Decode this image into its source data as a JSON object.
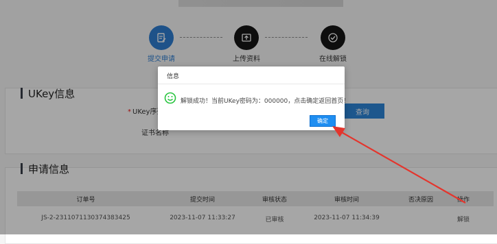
{
  "steps": [
    {
      "label": "提交申请",
      "icon": "edit-icon",
      "color": "#2f7fd3"
    },
    {
      "label": "上传资料",
      "icon": "upload-icon",
      "color": "#161616"
    },
    {
      "label": "在线解锁",
      "icon": "check-icon",
      "color": "#161616"
    }
  ],
  "ukey": {
    "title": "UKey信息",
    "serial_label": "UKey序列号",
    "serial_required_mark": "*",
    "cert_label": "证书名称",
    "query_button": "查询"
  },
  "apply": {
    "title": "申请信息",
    "columns": [
      "订单号",
      "提交时间",
      "审核状态",
      "审核时间",
      "否决原因",
      "操作"
    ],
    "rows": [
      [
        "JS-2-2311071130374383425",
        "2023-11-07 11:33:27",
        "已审核",
        "2023-11-07 11:34:39",
        "",
        "解锁"
      ]
    ]
  },
  "dialog": {
    "title": "信息",
    "message": "解锁成功！当前UKey密码为：000000，点击确定返回首页！",
    "ok_button": "确定",
    "icon": "smile-icon",
    "icon_color": "#28c43f"
  },
  "annotation": {
    "arrow_color": "#e4352d"
  }
}
